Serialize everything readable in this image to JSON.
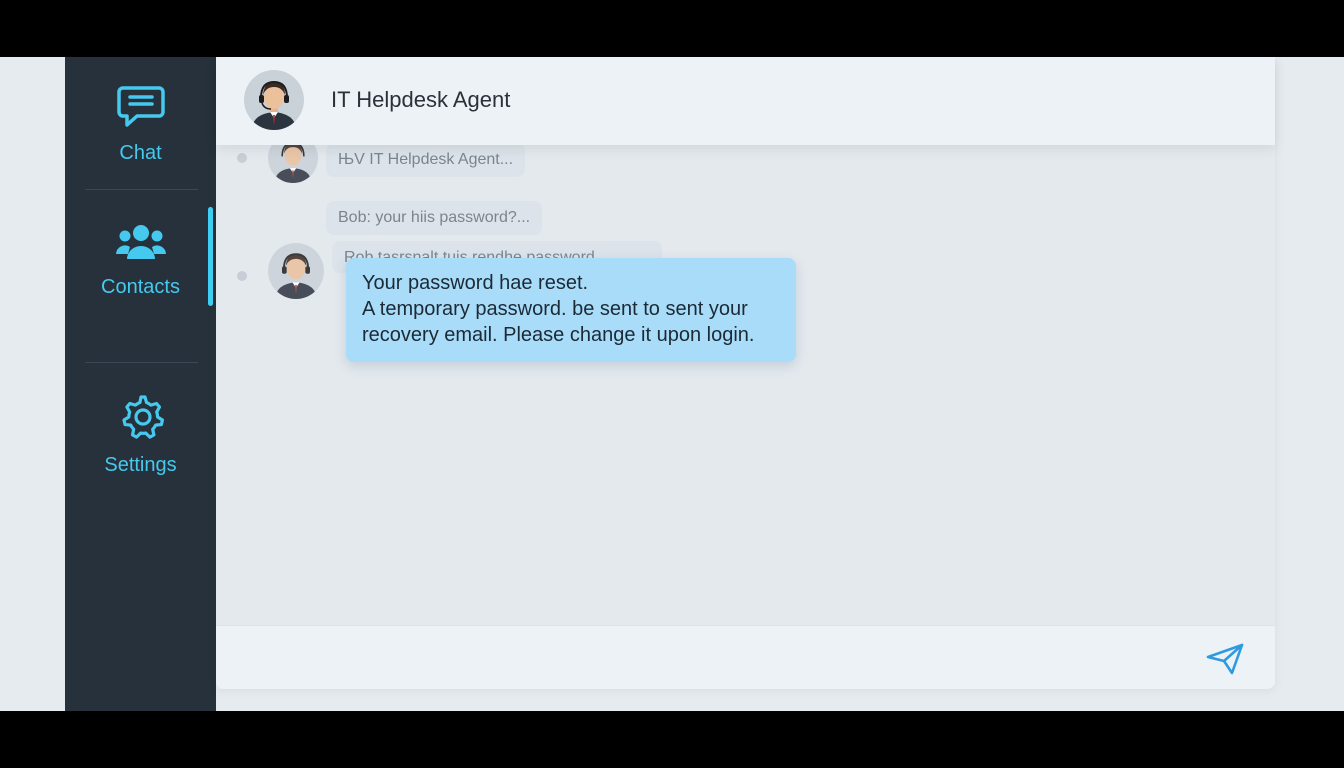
{
  "sidebar": {
    "items": [
      {
        "label": "Chat",
        "icon": "chat-icon"
      },
      {
        "label": "Contacts",
        "icon": "contacts-icon",
        "active": true
      },
      {
        "label": "Settings",
        "icon": "settings-icon"
      }
    ]
  },
  "header": {
    "title": "IT Helpdesk Agent",
    "avatar": "agent-avatar"
  },
  "messages": {
    "faded": [
      {
        "text": "ЊV IT Helpdesk Agent..."
      },
      {
        "text": "Bob: your hiis password?..."
      },
      {
        "text": "Rob tasrsnalt tuis rendhe password"
      }
    ],
    "main": {
      "lines": [
        "Your password hae reset.",
        "A temporary password. be sent to sent your",
        "recovery email. Please change it upon login."
      ]
    }
  },
  "composer": {
    "value": "",
    "placeholder": ""
  },
  "colors": {
    "sidebar_bg": "#26313b",
    "accent": "#45c9ee",
    "bubble": "#a8dcf9"
  }
}
